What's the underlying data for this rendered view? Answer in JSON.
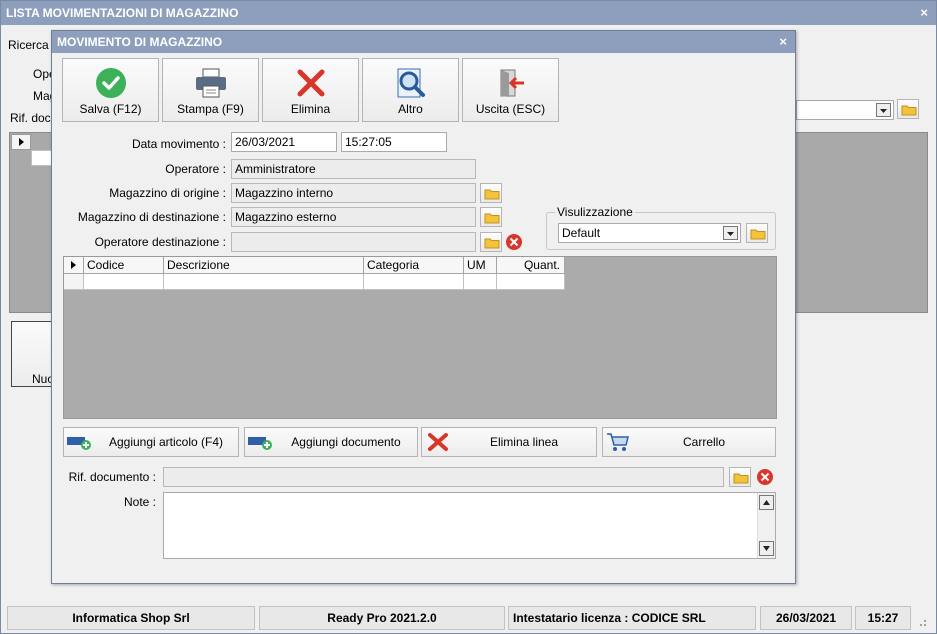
{
  "main_window": {
    "title": "LISTA MOVIMENTAZIONI DI MAGAZZINO",
    "close": "×",
    "labels": {
      "ricerca": "Ricerca (",
      "operatore": "Ope",
      "magazzino": "Mag",
      "rif_documento": "Rif. docu"
    },
    "default_select": "",
    "nuovo_label": "Nuo"
  },
  "dialog": {
    "title": "MOVIMENTO DI MAGAZZINO",
    "close": "×",
    "toolbar": {
      "salva": "Salva (F12)",
      "stampa": "Stampa (F9)",
      "elimina": "Elimina",
      "altro": "Altro",
      "uscita": "Uscita (ESC)"
    },
    "form": {
      "data_movimento_label": "Data movimento :",
      "data_movimento": "26/03/2021",
      "ora_movimento": "15:27:05",
      "operatore_label": "Operatore :",
      "operatore": "Amministratore",
      "magazzino_origine_label": "Magazzino di origine :",
      "magazzino_origine": "Magazzino interno",
      "magazzino_destinazione_label": "Magazzino di destinazione :",
      "magazzino_destinazione": "Magazzino esterno",
      "operatore_destinazione_label": "Operatore destinazione :",
      "operatore_destinazione": ""
    },
    "visualizzazione": {
      "label": "Visulizzazione",
      "selected": "Default"
    },
    "grid": {
      "columns": [
        "Codice",
        "Descrizione",
        "Categoria",
        "UM",
        "Quant."
      ]
    },
    "actions": {
      "aggiungi_articolo": "Aggiungi articolo (F4)",
      "aggiungi_documento": "Aggiungi documento",
      "elimina_linea": "Elimina linea",
      "carrello": "Carrello"
    },
    "rif_documento_label": "Rif. documento :",
    "rif_documento": "",
    "note_label": "Note :",
    "note": ""
  },
  "statusbar": {
    "company": "Informatica Shop Srl",
    "product": "Ready Pro 2021.2.0",
    "license": "Intestatario licenza : CODICE SRL",
    "date": "26/03/2021",
    "time": "15:27"
  },
  "colors": {
    "titlebar": "#8d9fbd",
    "grid_bg": "#ababab",
    "accent_green": "#3cb15a",
    "accent_red": "#d9362b"
  }
}
